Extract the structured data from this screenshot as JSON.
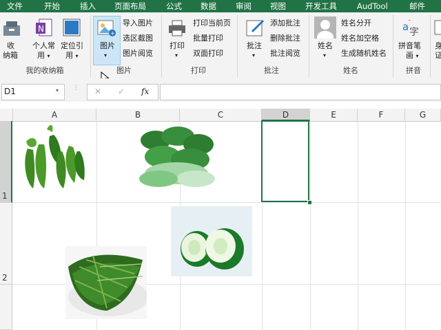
{
  "menu": [
    "文件",
    "开始",
    "插入",
    "页面布局",
    "公式",
    "数据",
    "审阅",
    "视图",
    "开发工具",
    "AudTool",
    "邮件"
  ],
  "ribbon": {
    "shoucang": {
      "line1": "收",
      "line2": "纳箱",
      "group": "我的收纳箱"
    },
    "personal": {
      "line1": "个人常",
      "line2": "用",
      "arrow": "▾"
    },
    "locate": {
      "line1": "定位引",
      "line2": "用",
      "arrow": "▾"
    },
    "picture": {
      "label": "图片",
      "arrow": "▾",
      "group": "图片",
      "items": [
        "导入图片",
        "选区截图",
        "图片阅览"
      ]
    },
    "print": {
      "label": "打印",
      "arrow": "▾",
      "group": "打印",
      "items": [
        "打印当前页",
        "批量打印",
        "双面打印"
      ]
    },
    "comment": {
      "label": "批注",
      "arrow": "▾",
      "group": "批注",
      "items": [
        "添加批注",
        "删除批注",
        "批注阅览"
      ]
    },
    "name": {
      "label": "姓名",
      "arrow": "▾",
      "group": "姓名",
      "items": [
        "姓名分开",
        "姓名加空格",
        "生成随机姓名"
      ]
    },
    "pinyin": {
      "label": "拼音笔",
      "line2": "画",
      "arrow": "▾",
      "group": "拼音"
    },
    "extra": {
      "line1": "身",
      "line2": "证"
    }
  },
  "formula_bar": {
    "cell_ref": "D1",
    "cancel": "✕",
    "confirm": "✓",
    "fx": "fx",
    "formula": ""
  },
  "columns": [
    "A",
    "B",
    "C",
    "D",
    "E",
    "F",
    "G"
  ],
  "rows": [
    "1",
    "2"
  ],
  "selected_cell": "D1",
  "pictures": [
    "chili-peppers",
    "bok-choy",
    "cucumber-slices",
    "leafy-greens"
  ],
  "colors": {
    "accent": "#217346",
    "selection": "#217346"
  }
}
